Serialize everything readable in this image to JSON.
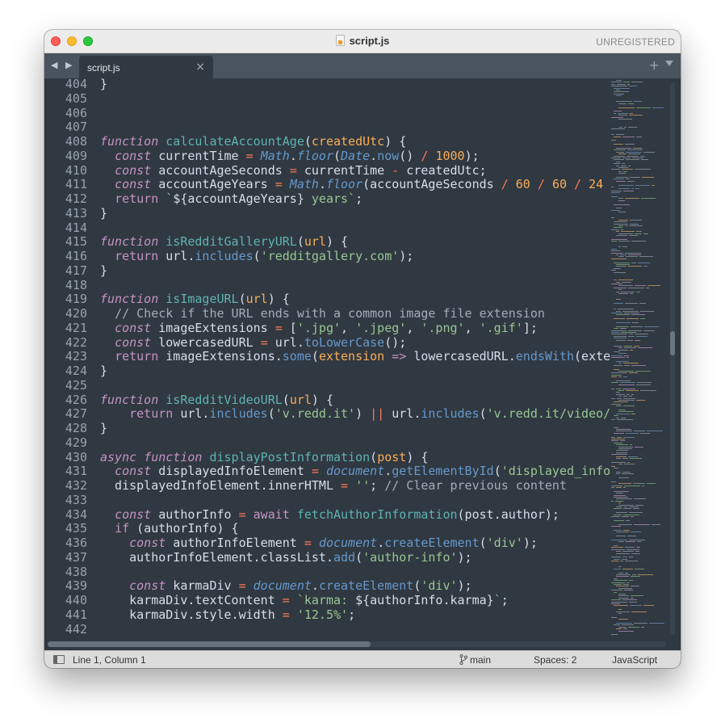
{
  "window": {
    "title": "script.js",
    "unregistered": "UNREGISTERED"
  },
  "tabbar": {
    "arrows": "◀ ▶",
    "tab_label": "script.js",
    "close_glyph": "×",
    "add_glyph": "+"
  },
  "gutter": {
    "line_numbers": [
      "404",
      "405",
      "406",
      "407",
      "408",
      "409",
      "410",
      "411",
      "412",
      "413",
      "414",
      "415",
      "416",
      "417",
      "418",
      "419",
      "420",
      "421",
      "422",
      "423",
      "424",
      "425",
      "426",
      "427",
      "428",
      "429",
      "430",
      "431",
      "432",
      "433",
      "434",
      "435",
      "436",
      "437",
      "438",
      "439",
      "440",
      "441",
      "442"
    ]
  },
  "code_lines": [
    [
      [
        "p",
        "}"
      ]
    ],
    [],
    [],
    [],
    [
      [
        "kw",
        "function"
      ],
      [
        "p",
        " "
      ],
      [
        "fn",
        "calculateAccountAge"
      ],
      [
        "p",
        "("
      ],
      [
        "pa",
        "createdUtc"
      ],
      [
        "p",
        ") {"
      ]
    ],
    [
      [
        "p",
        "  "
      ],
      [
        "kw",
        "const"
      ],
      [
        "p",
        " currentTime "
      ],
      [
        "op",
        "="
      ],
      [
        "p",
        " "
      ],
      [
        "bi",
        "Math"
      ],
      [
        "p",
        "."
      ],
      [
        "bi",
        "floor"
      ],
      [
        "p",
        "("
      ],
      [
        "bi",
        "Date"
      ],
      [
        "p",
        "."
      ],
      [
        "me",
        "now"
      ],
      [
        "p",
        "() "
      ],
      [
        "op",
        "/"
      ],
      [
        "p",
        " "
      ],
      [
        "nu",
        "1000"
      ],
      [
        "p",
        ");"
      ]
    ],
    [
      [
        "p",
        "  "
      ],
      [
        "kw",
        "const"
      ],
      [
        "p",
        " accountAgeSeconds "
      ],
      [
        "op",
        "="
      ],
      [
        "p",
        " currentTime "
      ],
      [
        "op",
        "-"
      ],
      [
        "p",
        " createdUtc;"
      ]
    ],
    [
      [
        "p",
        "  "
      ],
      [
        "kw",
        "const"
      ],
      [
        "p",
        " accountAgeYears "
      ],
      [
        "op",
        "="
      ],
      [
        "p",
        " "
      ],
      [
        "bi",
        "Math"
      ],
      [
        "p",
        "."
      ],
      [
        "bi",
        "floor"
      ],
      [
        "p",
        "(accountAgeSeconds "
      ],
      [
        "op",
        "/"
      ],
      [
        "p",
        " "
      ],
      [
        "nu",
        "60"
      ],
      [
        "p",
        " "
      ],
      [
        "op",
        "/"
      ],
      [
        "p",
        " "
      ],
      [
        "nu",
        "60"
      ],
      [
        "p",
        " "
      ],
      [
        "op",
        "/"
      ],
      [
        "p",
        " "
      ],
      [
        "nu",
        "24"
      ],
      [
        "p",
        " "
      ],
      [
        "op",
        "/"
      ]
    ],
    [
      [
        "p",
        "  "
      ],
      [
        "kwn",
        "return"
      ],
      [
        "p",
        " "
      ],
      [
        "st",
        "`"
      ],
      [
        "p",
        "${accountAgeYears}"
      ],
      [
        "st",
        " years`"
      ],
      [
        "p",
        ";"
      ]
    ],
    [
      [
        "p",
        "}"
      ]
    ],
    [],
    [
      [
        "kw",
        "function"
      ],
      [
        "p",
        " "
      ],
      [
        "fn",
        "isRedditGalleryURL"
      ],
      [
        "p",
        "("
      ],
      [
        "pa",
        "url"
      ],
      [
        "p",
        ") {"
      ]
    ],
    [
      [
        "p",
        "  "
      ],
      [
        "kwn",
        "return"
      ],
      [
        "p",
        " url."
      ],
      [
        "me",
        "includes"
      ],
      [
        "p",
        "("
      ],
      [
        "st",
        "'redditgallery.com'"
      ],
      [
        "p",
        ");"
      ]
    ],
    [
      [
        "p",
        "}"
      ]
    ],
    [],
    [
      [
        "kw",
        "function"
      ],
      [
        "p",
        " "
      ],
      [
        "fn",
        "isImageURL"
      ],
      [
        "p",
        "("
      ],
      [
        "pa",
        "url"
      ],
      [
        "p",
        ") {"
      ]
    ],
    [
      [
        "p",
        "  "
      ],
      [
        "cm",
        "// Check if the URL ends with a common image file extension"
      ]
    ],
    [
      [
        "p",
        "  "
      ],
      [
        "kw",
        "const"
      ],
      [
        "p",
        " imageExtensions "
      ],
      [
        "op",
        "="
      ],
      [
        "p",
        " ["
      ],
      [
        "st",
        "'.jpg'"
      ],
      [
        "p",
        ", "
      ],
      [
        "st",
        "'.jpeg'"
      ],
      [
        "p",
        ", "
      ],
      [
        "st",
        "'.png'"
      ],
      [
        "p",
        ", "
      ],
      [
        "st",
        "'.gif'"
      ],
      [
        "p",
        "];"
      ]
    ],
    [
      [
        "p",
        "  "
      ],
      [
        "kw",
        "const"
      ],
      [
        "p",
        " lowercasedURL "
      ],
      [
        "op",
        "="
      ],
      [
        "p",
        " url."
      ],
      [
        "me",
        "toLowerCase"
      ],
      [
        "p",
        "();"
      ]
    ],
    [
      [
        "p",
        "  "
      ],
      [
        "kwn",
        "return"
      ],
      [
        "p",
        " imageExtensions."
      ],
      [
        "me",
        "some"
      ],
      [
        "p",
        "("
      ],
      [
        "pa",
        "extension"
      ],
      [
        "p",
        " "
      ],
      [
        "kwn",
        "=>"
      ],
      [
        "p",
        " lowercasedURL."
      ],
      [
        "me",
        "endsWith"
      ],
      [
        "p",
        "(extension));"
      ]
    ],
    [
      [
        "p",
        "}"
      ]
    ],
    [],
    [
      [
        "kw",
        "function"
      ],
      [
        "p",
        " "
      ],
      [
        "fn",
        "isRedditVideoURL"
      ],
      [
        "p",
        "("
      ],
      [
        "pa",
        "url"
      ],
      [
        "p",
        ") {"
      ]
    ],
    [
      [
        "p",
        "    "
      ],
      [
        "kwn",
        "return"
      ],
      [
        "p",
        " url."
      ],
      [
        "me",
        "includes"
      ],
      [
        "p",
        "("
      ],
      [
        "st",
        "'v.redd.it'"
      ],
      [
        "p",
        ") "
      ],
      [
        "op",
        "||"
      ],
      [
        "p",
        " url."
      ],
      [
        "me",
        "includes"
      ],
      [
        "p",
        "("
      ],
      [
        "st",
        "'v.redd.it/video/'"
      ],
      [
        "p",
        ");"
      ]
    ],
    [
      [
        "p",
        "}"
      ]
    ],
    [],
    [
      [
        "kw",
        "async"
      ],
      [
        "p",
        " "
      ],
      [
        "kw",
        "function"
      ],
      [
        "p",
        " "
      ],
      [
        "fn",
        "displayPostInformation"
      ],
      [
        "p",
        "("
      ],
      [
        "pa",
        "post"
      ],
      [
        "p",
        ") {"
      ]
    ],
    [
      [
        "p",
        "  "
      ],
      [
        "kw",
        "const"
      ],
      [
        "p",
        " displayedInfoElement "
      ],
      [
        "op",
        "="
      ],
      [
        "p",
        " "
      ],
      [
        "bi",
        "document"
      ],
      [
        "p",
        "."
      ],
      [
        "me",
        "getElementById"
      ],
      [
        "p",
        "("
      ],
      [
        "st",
        "'displayed_info'"
      ],
      [
        "p",
        ");"
      ]
    ],
    [
      [
        "p",
        "  displayedInfoElement.innerHTML "
      ],
      [
        "op",
        "="
      ],
      [
        "p",
        " "
      ],
      [
        "st",
        "''"
      ],
      [
        "p",
        "; "
      ],
      [
        "cm",
        "// Clear previous content"
      ]
    ],
    [],
    [
      [
        "p",
        "  "
      ],
      [
        "kw",
        "const"
      ],
      [
        "p",
        " authorInfo "
      ],
      [
        "op",
        "="
      ],
      [
        "p",
        " "
      ],
      [
        "kwn",
        "await"
      ],
      [
        "p",
        " "
      ],
      [
        "fn",
        "fetchAuthorInformation"
      ],
      [
        "p",
        "(post.author);"
      ]
    ],
    [
      [
        "p",
        "  "
      ],
      [
        "kwn",
        "if"
      ],
      [
        "p",
        " (authorInfo) {"
      ]
    ],
    [
      [
        "p",
        "    "
      ],
      [
        "kw",
        "const"
      ],
      [
        "p",
        " authorInfoElement "
      ],
      [
        "op",
        "="
      ],
      [
        "p",
        " "
      ],
      [
        "bi",
        "document"
      ],
      [
        "p",
        "."
      ],
      [
        "me",
        "createElement"
      ],
      [
        "p",
        "("
      ],
      [
        "st",
        "'div'"
      ],
      [
        "p",
        ");"
      ]
    ],
    [
      [
        "p",
        "    authorInfoElement.classList."
      ],
      [
        "me",
        "add"
      ],
      [
        "p",
        "("
      ],
      [
        "st",
        "'author-info'"
      ],
      [
        "p",
        ");"
      ]
    ],
    [],
    [
      [
        "p",
        "    "
      ],
      [
        "kw",
        "const"
      ],
      [
        "p",
        " karmaDiv "
      ],
      [
        "op",
        "="
      ],
      [
        "p",
        " "
      ],
      [
        "bi",
        "document"
      ],
      [
        "p",
        "."
      ],
      [
        "me",
        "createElement"
      ],
      [
        "p",
        "("
      ],
      [
        "st",
        "'div'"
      ],
      [
        "p",
        ");"
      ]
    ],
    [
      [
        "p",
        "    karmaDiv.textContent "
      ],
      [
        "op",
        "="
      ],
      [
        "p",
        " "
      ],
      [
        "st",
        "`karma: "
      ],
      [
        "p",
        "${authorInfo.karma}"
      ],
      [
        "st",
        "`"
      ],
      [
        "p",
        ";"
      ]
    ],
    [
      [
        "p",
        "    karmaDiv.style.width "
      ],
      [
        "op",
        "="
      ],
      [
        "p",
        " "
      ],
      [
        "st",
        "'12.5%'"
      ],
      [
        "p",
        ";"
      ]
    ],
    []
  ],
  "statusbar": {
    "position": "Line 1, Column 1",
    "branch": "main",
    "spaces": "Spaces: 2",
    "syntax": "JavaScript"
  },
  "colors": {
    "background": "#303841",
    "keyword": "#c594c5",
    "function": "#5fb4b4",
    "parameter": "#f9ae58",
    "string": "#99c794",
    "operator": "#f97b58",
    "method": "#6699cc",
    "comment": "#a6acb9",
    "text": "#d8dee9"
  }
}
